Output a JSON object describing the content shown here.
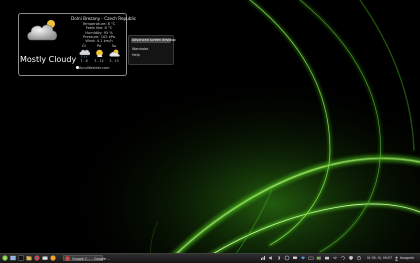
{
  "weather": {
    "location": "Dolni Brezany - Czech Republic",
    "condition": "Mostly Cloudy",
    "stats": [
      "Temperature: 8 °C",
      "Feels like: 8 °C",
      "Humidity: 93 %",
      "Pressure: 102 kPa",
      "Wind: 4.1 km/h"
    ],
    "forecast": [
      {
        "day": "Čt",
        "temp": "7 - 8",
        "icon": "cloud-rain-icon"
      },
      {
        "day": "Pá",
        "temp": "3 - 12",
        "icon": "sun-cloud-icon"
      },
      {
        "day": "So",
        "temp": "3 - 13",
        "icon": "cloud-sun-icon"
      }
    ],
    "credit": "AccuWeather.com"
  },
  "context_menu": {
    "items": [
      "Advanced screen desktop",
      "Wardrobe",
      "Help"
    ]
  },
  "taskbar": {
    "task_label": "Google C... - Google ...",
    "clock": "Út 09. říj. 09:57",
    "user": "fossgeek"
  },
  "colors": {
    "wallpaper_glow": "#5fd21d",
    "background": "#000000",
    "taskbar": "#222222"
  }
}
